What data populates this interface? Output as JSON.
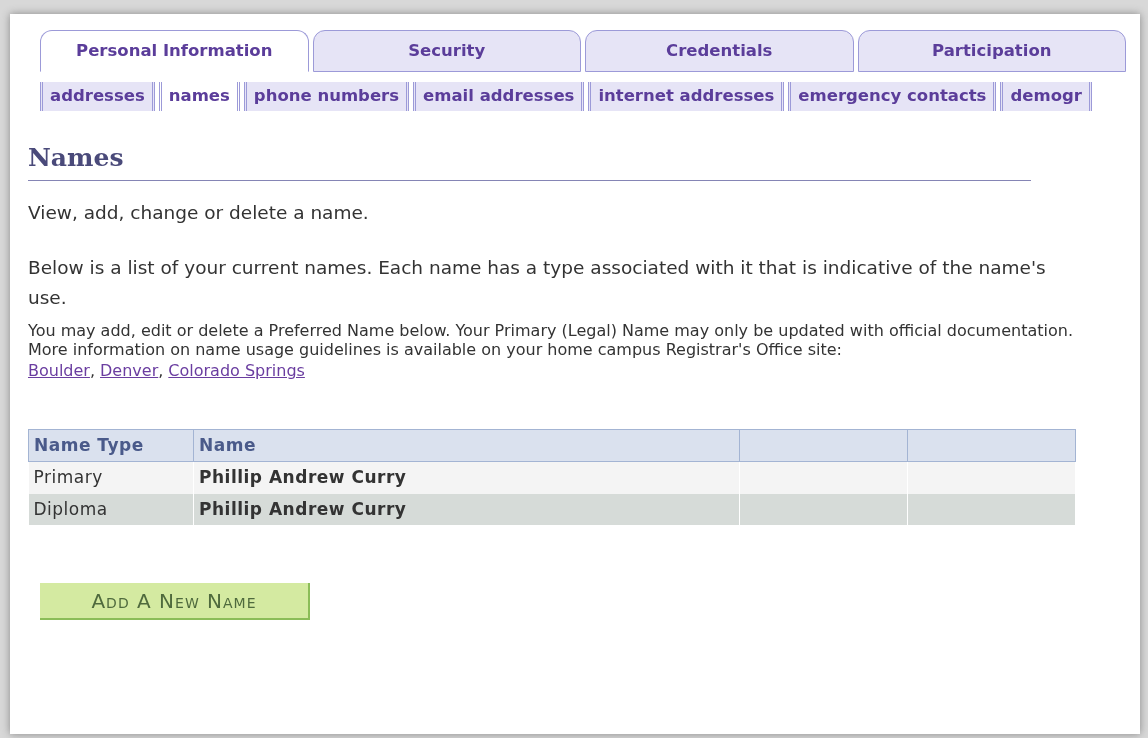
{
  "tabs": [
    {
      "label": "Personal Information",
      "selected": true
    },
    {
      "label": "Security",
      "selected": false
    },
    {
      "label": "Credentials",
      "selected": false
    },
    {
      "label": "Participation",
      "selected": false
    }
  ],
  "subtabs": [
    {
      "label": "addresses",
      "selected": false
    },
    {
      "label": "names",
      "selected": true
    },
    {
      "label": "phone numbers",
      "selected": false
    },
    {
      "label": "email addresses",
      "selected": false
    },
    {
      "label": "internet addresses",
      "selected": false
    },
    {
      "label": "emergency contacts",
      "selected": false
    },
    {
      "label": "demogr",
      "selected": false
    }
  ],
  "heading": "Names",
  "intro": "View, add, change or delete a name.",
  "description": "Below is a list of your current names. Each name has a type associated with it that is indicative of the name's use.",
  "note": "You may add, edit or delete a Preferred Name below. Your Primary (Legal) Name may only be updated with official documentation. More information on name usage guidelines is available on your home campus Registrar's Office site:",
  "links": [
    "Boulder",
    "Denver",
    "Colorado Springs"
  ],
  "link_separator": ",",
  "table": {
    "columns": [
      "Name Type",
      "Name"
    ],
    "rows": [
      [
        "Primary",
        "Phillip Andrew Curry"
      ],
      [
        "Diploma",
        "Phillip Andrew Curry"
      ]
    ]
  },
  "add_button": "Add A New Name"
}
